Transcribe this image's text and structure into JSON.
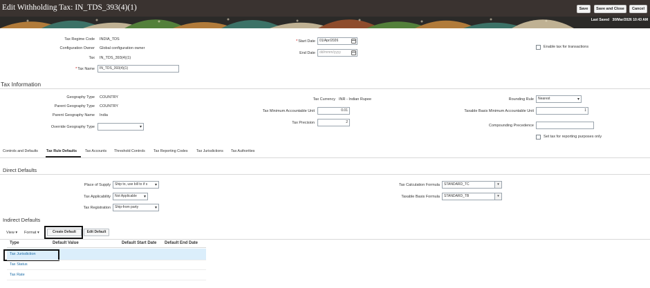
{
  "header": {
    "title": "Edit Withholding Tax: IN_TDS_393(4)(1)",
    "save_label": "Save",
    "save_close_label": "Save and Close",
    "cancel_label": "Cancel",
    "last_saved_label": "Last Saved",
    "last_saved_value": "30/Mar/2026 10:43 AM"
  },
  "form": {
    "tax_regime_code_label": "Tax Regime Code",
    "tax_regime_code_value": "INDIA_TDS",
    "config_owner_label": "Configuration Owner",
    "config_owner_value": "Global configuration owner",
    "tax_label": "Tax",
    "tax_value": "IN_TDS_393(4)(1)",
    "tax_name_label": "Tax Name",
    "tax_name_value": "IN_TDS_393(4)(1)",
    "start_date_label": "Start Date",
    "start_date_value": "01/Apr/2026",
    "end_date_label": "End Date",
    "end_date_placeholder": "dd/mmm/yyyy",
    "enable_tax_label": "Enable tax for transactions"
  },
  "tax_info": {
    "section_title": "Tax Information",
    "geo_type_label": "Geography Type",
    "geo_type_value": "COUNTRY",
    "parent_geo_type_label": "Parent Geography Type",
    "parent_geo_type_value": "COUNTRY",
    "parent_geo_name_label": "Parent Geography Name",
    "parent_geo_name_value": "India",
    "override_geo_type_label": "Override Geography Type",
    "tax_currency_label": "Tax Currency",
    "tax_currency_value": "INR - Indian Rupee",
    "tax_min_unit_label": "Tax Minimum Accountable Unit",
    "tax_min_unit_value": "0.01",
    "tax_precision_label": "Tax Precision",
    "tax_precision_value": "2",
    "rounding_rule_label": "Rounding Rule",
    "rounding_rule_value": "Nearest",
    "taxable_basis_min_label": "Taxable Basis Minimum Accountable Unit",
    "taxable_basis_min_value": "1",
    "compounding_label": "Compounding Precedence",
    "reporting_label": "Set tax for reporting purposes only"
  },
  "tabs": [
    {
      "label": "Controls and Defaults"
    },
    {
      "label": "Tax Rule Defaults"
    },
    {
      "label": "Tax Accounts"
    },
    {
      "label": "Threshold Controls"
    },
    {
      "label": "Tax Reporting Codes"
    },
    {
      "label": "Tax Jurisdictions"
    },
    {
      "label": "Tax Authorities"
    }
  ],
  "direct_defaults": {
    "section_title": "Direct Defaults",
    "place_of_supply_label": "Place of Supply",
    "place_of_supply_value": "Ship to, use bill to if s",
    "tax_applicability_label": "Tax Applicability",
    "tax_applicability_value": "Not Applicable",
    "tax_registration_label": "Tax Registration",
    "tax_registration_value": "Ship-from party",
    "tax_calc_formula_label": "Tax Calculation Formula",
    "tax_calc_formula_value": "STANDARD_TC",
    "taxable_basis_formula_label": "Taxable Basis Formula",
    "taxable_basis_formula_value": "STANDARD_TB"
  },
  "indirect_defaults": {
    "section_title": "Indirect Defaults",
    "view_label": "View",
    "format_label": "Format",
    "create_label": "Create Default",
    "edit_label": "Edit Default",
    "columns": [
      "Type",
      "Default Value",
      "Default Start Date",
      "Default End Date"
    ],
    "rows": [
      {
        "type": "Tax Jurisdiction"
      },
      {
        "type": "Tax Status"
      },
      {
        "type": "Tax Rate"
      }
    ]
  },
  "colors": {
    "header_bg": "#3a3330",
    "link": "#1e6ea8",
    "selected_row": "#dbeefb"
  }
}
